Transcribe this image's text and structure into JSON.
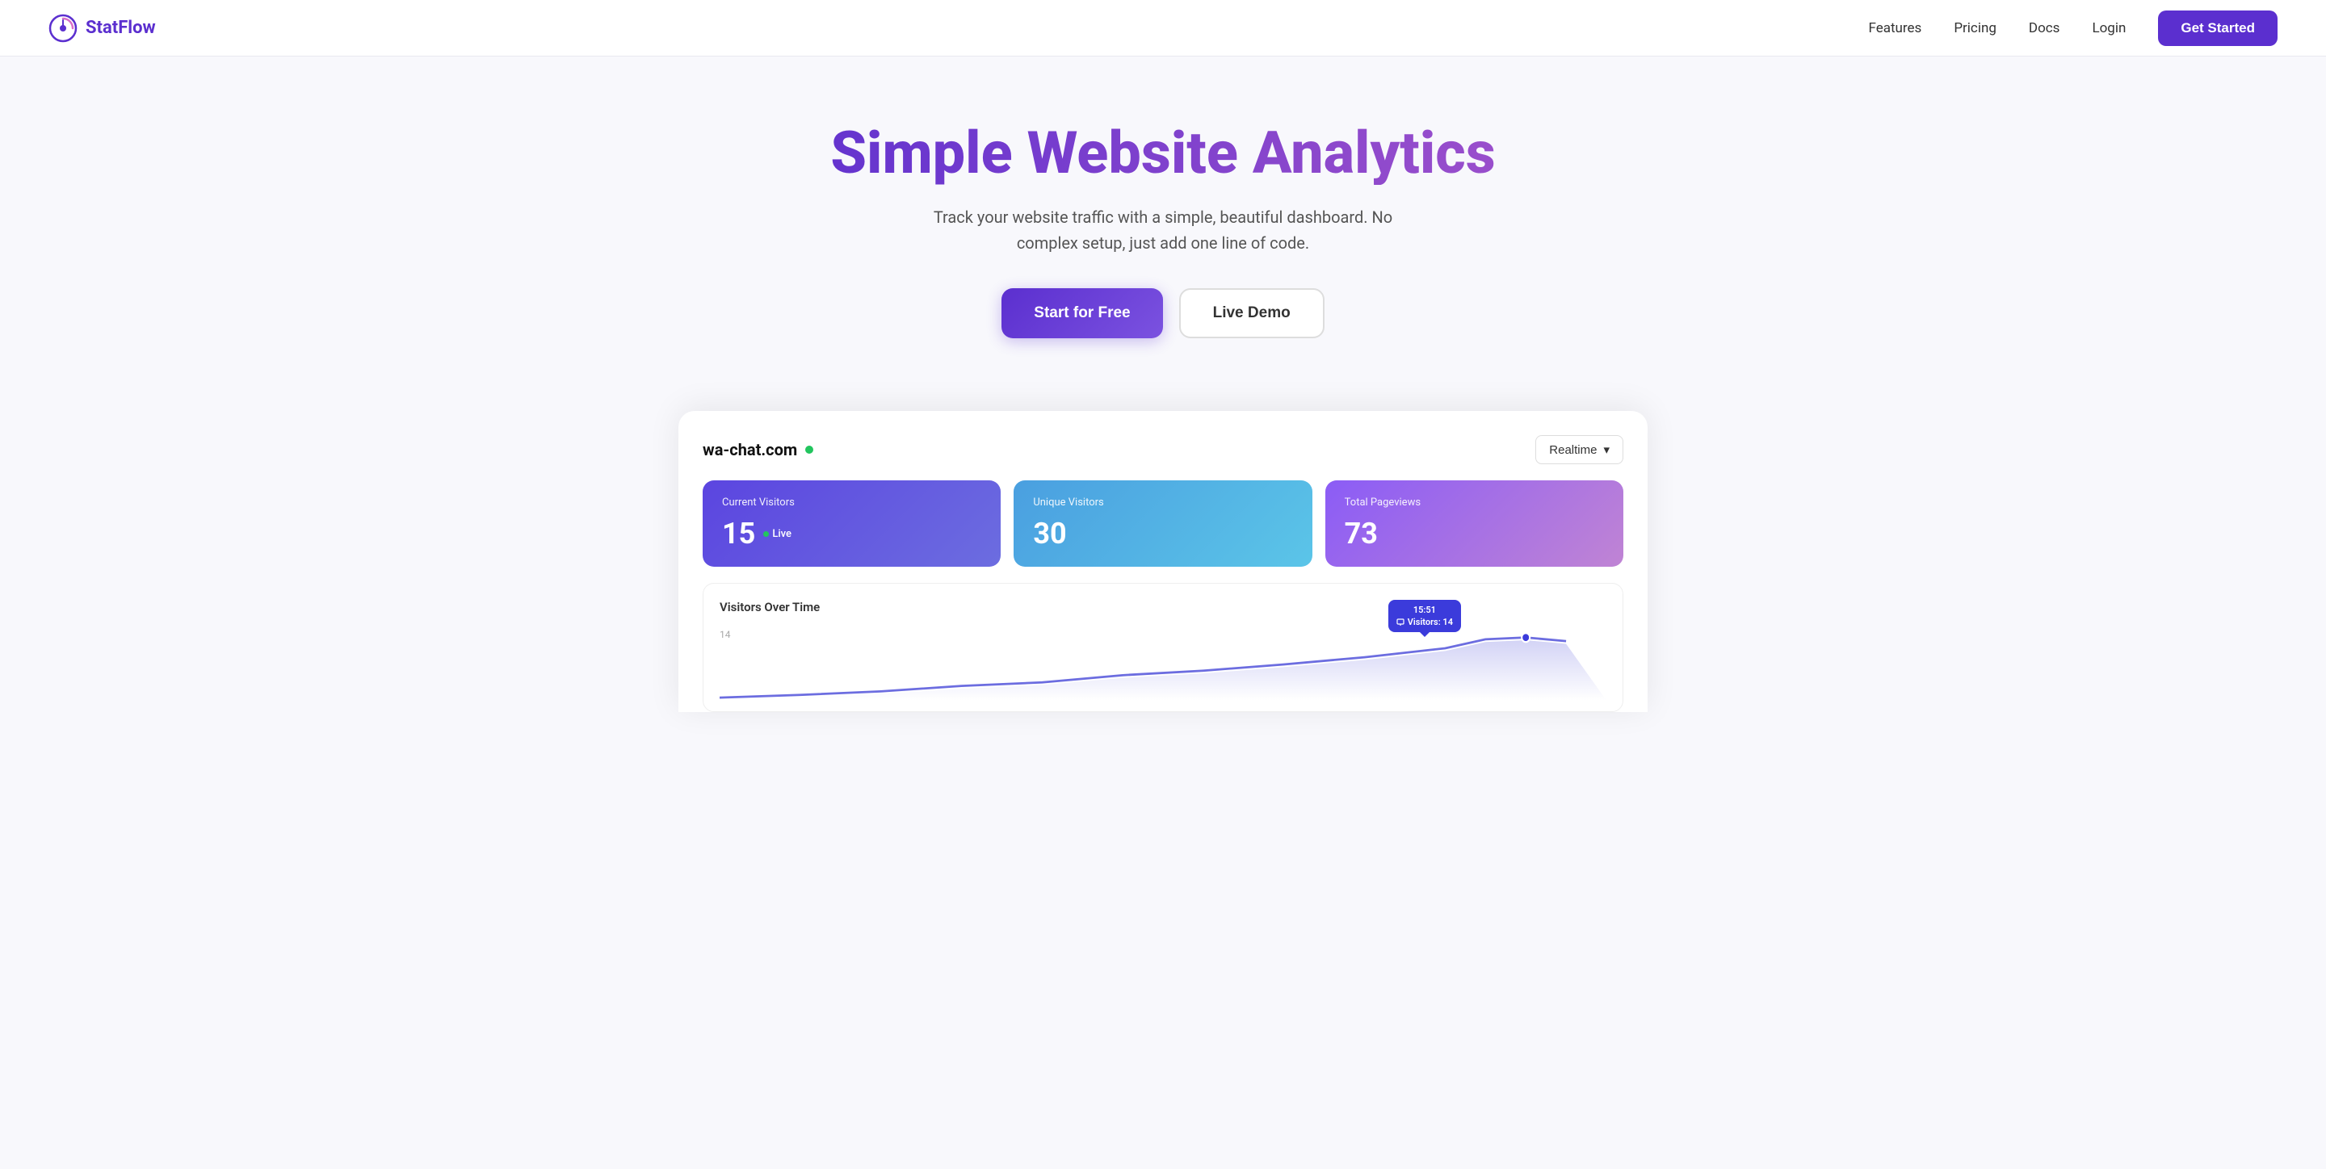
{
  "nav": {
    "logo_text": "StatFlow",
    "links": [
      {
        "label": "Features",
        "id": "features"
      },
      {
        "label": "Pricing",
        "id": "pricing"
      },
      {
        "label": "Docs",
        "id": "docs"
      },
      {
        "label": "Login",
        "id": "login"
      }
    ],
    "cta_label": "Get Started"
  },
  "hero": {
    "title_part1": "Simple Website",
    "title_part2": "Analytics",
    "subtitle": "Track your website traffic with a simple, beautiful dashboard. No complex setup, just add one line of code.",
    "btn_start": "Start for Free",
    "btn_demo": "Live Demo"
  },
  "dashboard": {
    "site_name": "wa-chat.com",
    "realtime_label": "Realtime",
    "stats": [
      {
        "label": "Current Visitors",
        "value": "15",
        "live": true,
        "live_label": "Live"
      },
      {
        "label": "Unique Visitors",
        "value": "30",
        "live": false
      },
      {
        "label": "Total Pageviews",
        "value": "73",
        "live": false
      }
    ],
    "chart": {
      "title": "Visitors Over Time",
      "y_value": "14",
      "tooltip_time": "15:51",
      "tooltip_visitors": "Visitors: 14"
    }
  }
}
